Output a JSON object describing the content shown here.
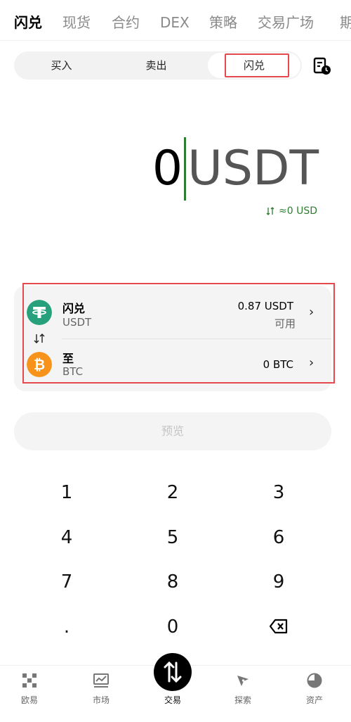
{
  "top_tabs": [
    "闪兑",
    "现货",
    "合约",
    "DEX",
    "策略",
    "交易广场",
    "期"
  ],
  "segment": {
    "buy": "买入",
    "sell": "卖出",
    "convert": "闪兑"
  },
  "amount": {
    "value": "0",
    "unit": "USDT",
    "usd_approx": "≈0 USD"
  },
  "from": {
    "label": "闪兑",
    "coin": "USDT",
    "balance": "0.87 USDT",
    "balance_note": "可用"
  },
  "to": {
    "label": "至",
    "coin": "BTC",
    "amount": "0 BTC"
  },
  "preview_label": "预览",
  "keypad": [
    "1",
    "2",
    "3",
    "4",
    "5",
    "6",
    "7",
    "8",
    "9",
    ".",
    "0"
  ],
  "bottom_nav": {
    "home": "欧易",
    "market": "市场",
    "trade": "交易",
    "explore": "探索",
    "assets": "资产"
  },
  "icons": {
    "history": "history-clock-icon",
    "swap": "swap-arrows-icon",
    "usdt": "usdt-coin-icon",
    "btc": "btc-coin-icon",
    "chevron": "chevron-right-icon",
    "backspace": "backspace-icon"
  },
  "colors": {
    "accent_green": "#2e7d32",
    "usdt_green": "#26a17b",
    "btc_orange": "#f7931a",
    "highlight_red": "#e5484d"
  }
}
